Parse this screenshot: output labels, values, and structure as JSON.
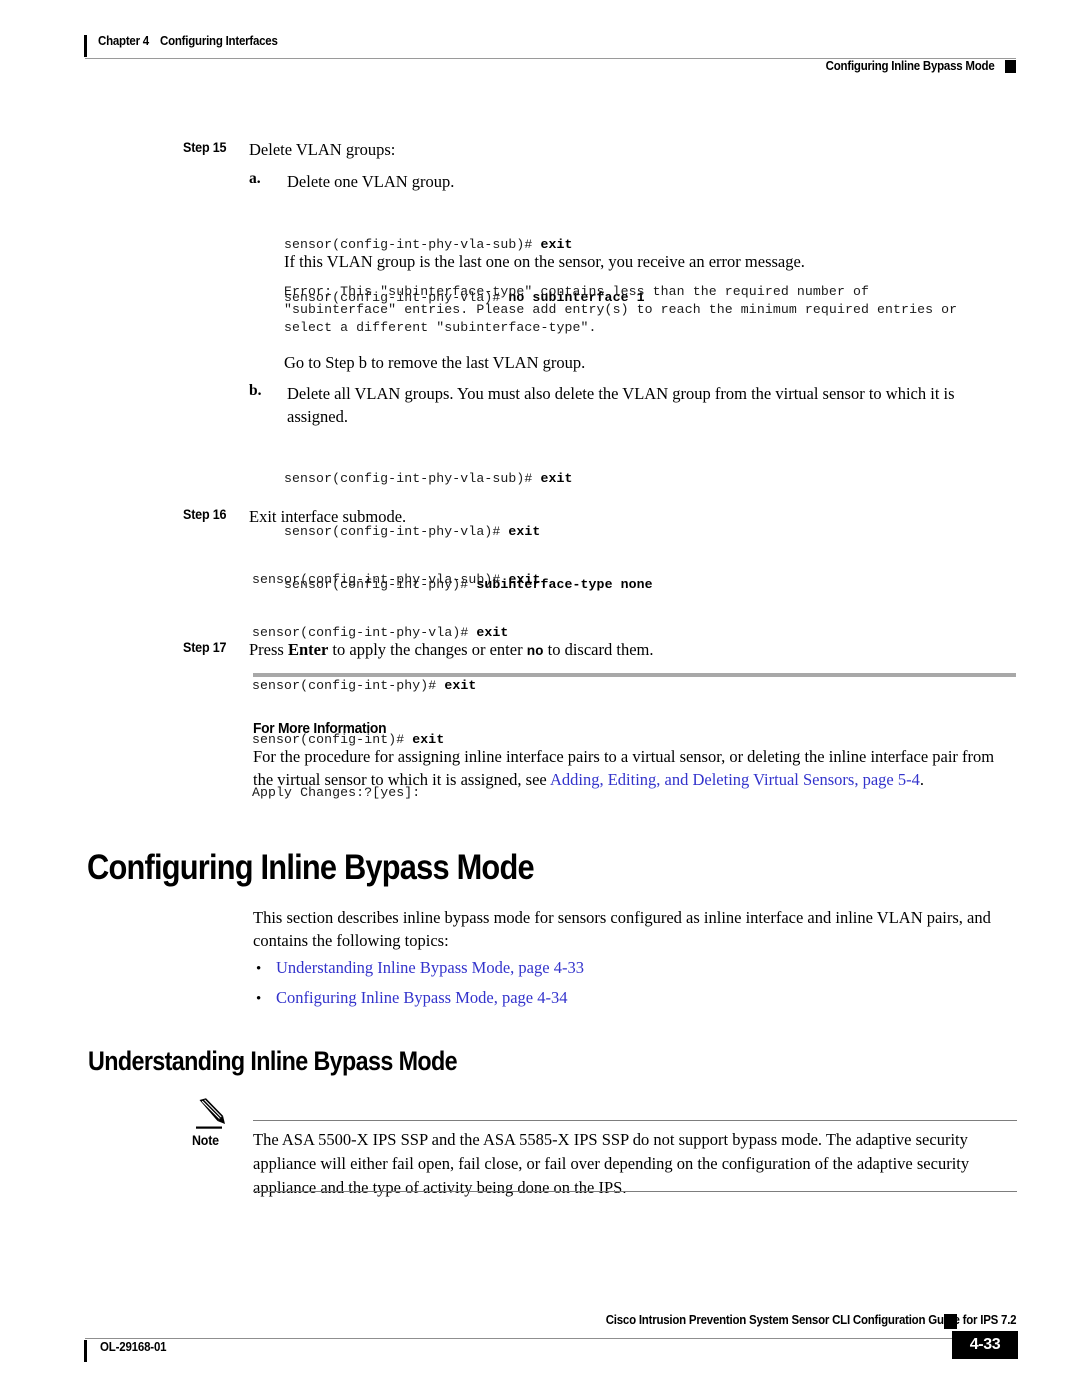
{
  "header": {
    "chapter": "Chapter 4",
    "chapter_title": "Configuring Interfaces",
    "section": "Configuring Inline Bypass Mode"
  },
  "steps": {
    "step15": {
      "label": "Step 15",
      "text": "Delete VLAN groups:",
      "sub_a": {
        "label": "a.",
        "text": "Delete one VLAN group.",
        "code": [
          {
            "prompt": "sensor(config-int-phy-vla-sub)# ",
            "cmd": "exit"
          },
          {
            "prompt": "sensor(config-int-phy-vla)# ",
            "cmd": "no subinterface 1"
          }
        ]
      },
      "error_intro": "If this VLAN group is the last one on the sensor, you receive an error message.",
      "error_text": "Error: This \"subinterface-type\" contains less than the required number of\n\"subinterface\" entries. Please add entry(s) to reach the minimum required entries or\nselect a different \"subinterface-type\".",
      "goto_text": "Go to Step b to remove the last VLAN group.",
      "sub_b": {
        "label": "b.",
        "text": "Delete all VLAN groups. You must also delete the VLAN group from the virtual sensor to which it is assigned.",
        "code": [
          {
            "prompt": "sensor(config-int-phy-vla-sub)# ",
            "cmd": "exit"
          },
          {
            "prompt": "sensor(config-int-phy-vla)# ",
            "cmd": "exit"
          },
          {
            "prompt": "sensor(config-int-phy)# ",
            "cmd": "subinterface-type none"
          }
        ]
      }
    },
    "step16": {
      "label": "Step 16",
      "text": "Exit interface submode.",
      "code": [
        {
          "prompt": "sensor(config-int-phy-vla-sub)# ",
          "cmd": "exit"
        },
        {
          "prompt": "sensor(config-int-phy-vla)# ",
          "cmd": "exit"
        },
        {
          "prompt": "sensor(config-int-phy)# ",
          "cmd": "exit"
        },
        {
          "prompt": "sensor(config-int)# ",
          "cmd": "exit"
        },
        {
          "prompt": "Apply Changes:?[yes]:",
          "cmd": ""
        }
      ]
    },
    "step17": {
      "label": "Step 17",
      "text_1": "Press ",
      "bold_1": "Enter",
      "text_2": " to apply the changes or enter ",
      "mono_1": "no",
      "text_3": " to discard them."
    }
  },
  "for_more_information": {
    "heading": "For More Information",
    "body_1": "For the procedure for assigning inline interface pairs to a virtual sensor, or deleting the inline interface pair from the virtual sensor to which it is assigned, see ",
    "link": "Adding, Editing, and Deleting Virtual Sensors, page 5-4",
    "body_2": "."
  },
  "section_main": {
    "title": "Configuring Inline Bypass Mode",
    "intro": "This section describes inline bypass mode for sensors configured as inline interface and inline VLAN pairs, and contains the following topics:",
    "bullet_char": "•",
    "topics": [
      "Understanding Inline Bypass Mode, page 4-33",
      "Configuring Inline Bypass Mode, page 4-34"
    ]
  },
  "subsection": {
    "title": "Understanding Inline Bypass Mode"
  },
  "note": {
    "label": "Note",
    "body": "The ASA 5500-X IPS SSP and the ASA 5585-X IPS SSP do not support bypass mode. The adaptive security appliance will either fail open, fail close, or fail over depending on the configuration of the adaptive security appliance and the type of activity being done on the IPS."
  },
  "footer": {
    "title": "Cisco Intrusion Prevention System Sensor CLI Configuration Guide for IPS 7.2",
    "doc_id": "OL-29168-01",
    "page_number": "4-33"
  },
  "colors": {
    "link": "#3333CC",
    "rule": "#8F8F8F",
    "divider": "#A8A8A8"
  }
}
